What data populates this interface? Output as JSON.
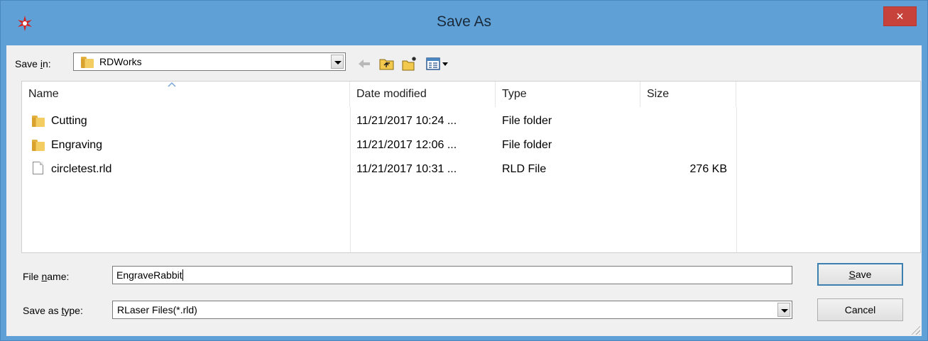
{
  "window": {
    "title": "Save As",
    "close_label": "×",
    "accent": "#5fa0d6",
    "close_color": "#c7423a"
  },
  "toolbar": {
    "save_in_pre": "Save ",
    "save_in_ul": "i",
    "save_in_post": "n:",
    "location": "RDWorks",
    "icons": [
      "back-arrow-icon",
      "up-folder-icon",
      "new-folder-icon",
      "view-menu-icon"
    ]
  },
  "filelist": {
    "columns": [
      "Name",
      "Date modified",
      "Type",
      "Size"
    ],
    "rows": [
      {
        "name": "Cutting",
        "date": "11/21/2017 10:24 ...",
        "type": "File folder",
        "size": "",
        "icon": "folder-icon"
      },
      {
        "name": "Engraving",
        "date": "11/21/2017 12:06 ...",
        "type": "File folder",
        "size": "",
        "icon": "folder-icon"
      },
      {
        "name": "circletest.rld",
        "date": "11/21/2017 10:31 ...",
        "type": "RLD File",
        "size": "276 KB",
        "icon": "file-icon"
      }
    ]
  },
  "form": {
    "filename_pre": "File ",
    "filename_ul": "n",
    "filename_post": "ame:",
    "filename_value": "EngraveRabbit",
    "type_pre": "Save as ",
    "type_ul": "t",
    "type_post": "ype:",
    "type_value": "RLaser Files(*.rld)"
  },
  "buttons": {
    "save_ul": "S",
    "save_rest": "ave",
    "cancel": "Cancel"
  }
}
